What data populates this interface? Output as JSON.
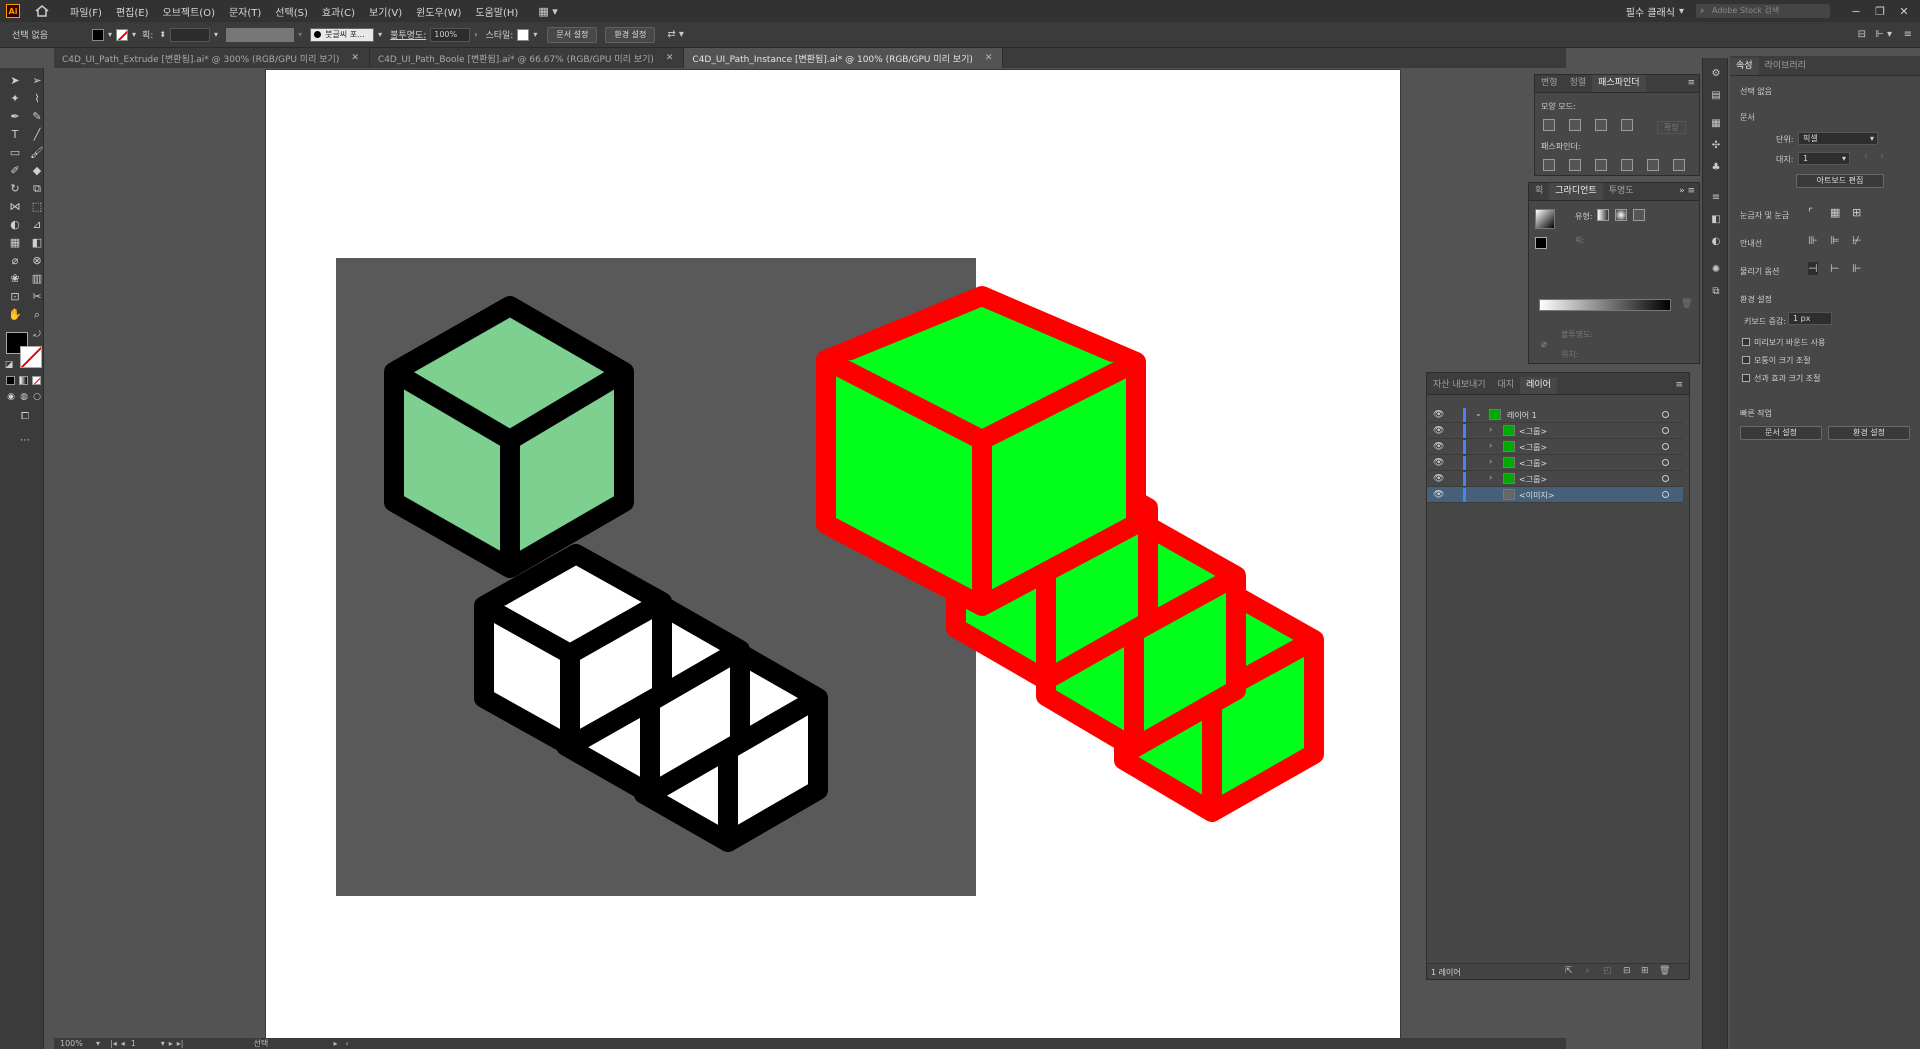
{
  "app": {
    "logo": "Ai"
  },
  "menu": [
    "파일(F)",
    "편집(E)",
    "오브젝트(O)",
    "문자(T)",
    "선택(S)",
    "효과(C)",
    "보기(V)",
    "윈도우(W)",
    "도움말(H)"
  ],
  "workspace": {
    "label": "필수 클래식",
    "stock_placeholder": "Adobe Stock 검색"
  },
  "controlbar": {
    "selection": "선택 없음",
    "stroke_label": "획:",
    "brush_label": "붓글씨 포...",
    "opacity_label": "불투명도:",
    "opacity_value": "100%",
    "style_label": "스타일:",
    "doc_setup": "문서 설정",
    "prefs": "환경 설정"
  },
  "tabs": [
    {
      "label": "C4D_UI_Path_Extrude [변환됨].ai* @ 300% (RGB/GPU 미리 보기)",
      "active": false
    },
    {
      "label": "C4D_UI_Path_Boole [변환됨].ai* @ 66.67% (RGB/GPU 미리 보기)",
      "active": false
    },
    {
      "label": "C4D_UI_Path_Instance [변환됨].ai* @ 100% (RGB/GPU 미리 보기)",
      "active": true
    }
  ],
  "status": {
    "zoom": "100%",
    "page": "1",
    "tool": "선택"
  },
  "pathfinder": {
    "tabs": [
      "변형",
      "정렬",
      "패스파인더"
    ],
    "shape_modes": "모양 모드:",
    "expand": "확장",
    "pathfinders": "패스파인더:"
  },
  "gradient": {
    "tabs": [
      "획",
      "그라디언트",
      "투명도"
    ],
    "type_label": "유형:",
    "stroke_label": "획:",
    "opacity_label": "불투명도:",
    "location_label": "위치:"
  },
  "layers": {
    "tabs": [
      "자산 내보내기",
      "대지",
      "레이어"
    ],
    "rows": [
      {
        "name": "레이어 1",
        "level": 0,
        "selected": false
      },
      {
        "name": "<그룹>",
        "level": 1,
        "selected": false
      },
      {
        "name": "<그룹>",
        "level": 1,
        "selected": false
      },
      {
        "name": "<그룹>",
        "level": 1,
        "selected": false
      },
      {
        "name": "<그룹>",
        "level": 1,
        "selected": false
      },
      {
        "name": "<이미지>",
        "level": 1,
        "selected": true
      }
    ],
    "footer": "1 레이어"
  },
  "properties": {
    "tabs": [
      "속성",
      "라이브러리"
    ],
    "no_selection": "선택 없음",
    "document": "문서",
    "units_label": "단위:",
    "units_value": "픽셀",
    "artboard_label": "대지:",
    "artboard_value": "1",
    "edit_artboards": "아트보드 편집",
    "rulers_grids": "눈금자 및 눈금",
    "guides": "안내선",
    "snap_options": "물리기 옵션",
    "preferences": "환경 설정",
    "keyboard_increment_label": "키보드 증감:",
    "keyboard_increment_value": "1 px",
    "use_preview_bounds": "미리보기 바운드 사용",
    "scale_corners": "모퉁이 크기 조절",
    "scale_strokes": "선과 효과 크기 조절",
    "quick_actions": "빠른 작업",
    "doc_setup_btn": "문서 설정",
    "prefs_btn": "환경 설정"
  },
  "colors": {
    "cube_light_green": "#7dd090",
    "cube_bright_green": "#00ff1a",
    "cube_red_stroke": "#ff0000",
    "image_bg": "#595959",
    "selected_layer": "#46607a"
  }
}
